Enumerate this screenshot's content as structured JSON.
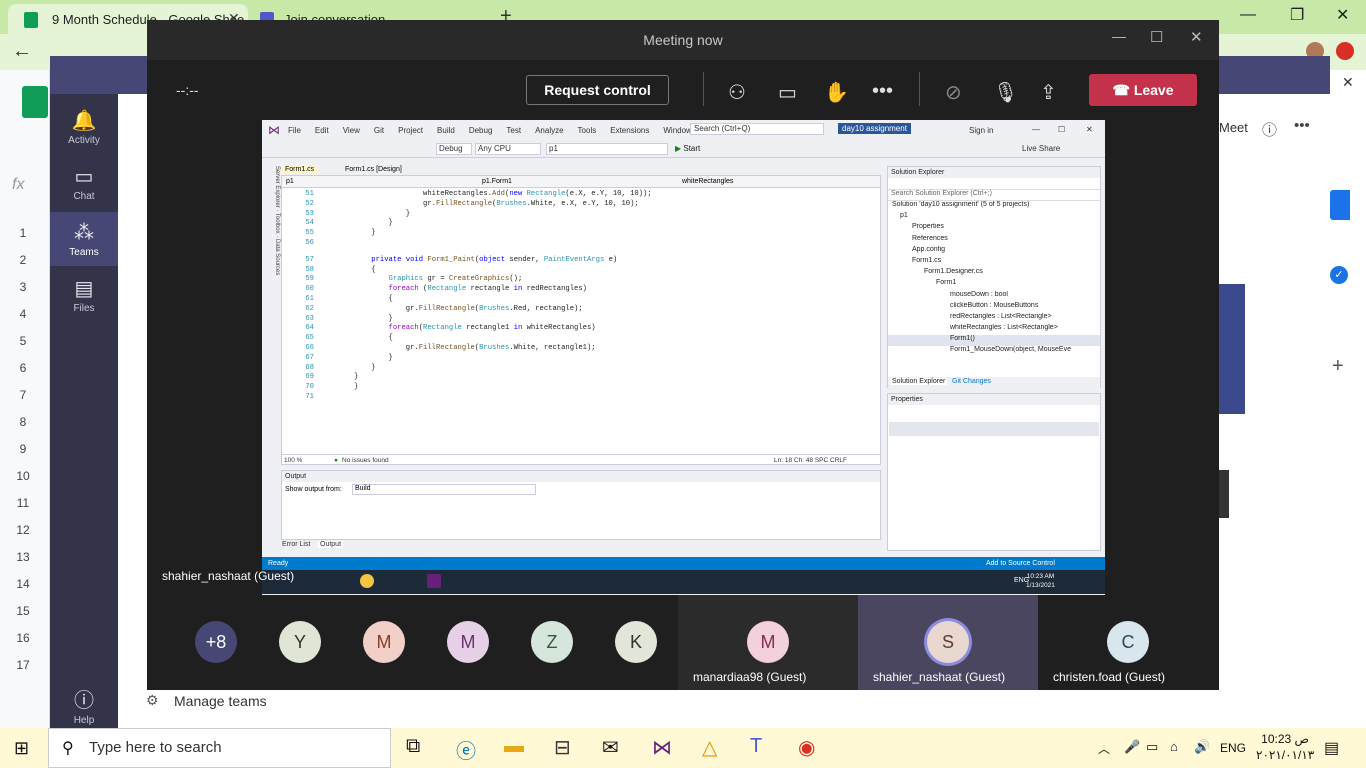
{
  "browser": {
    "tab1": "9 Month Schedule - Google Shee",
    "tab2": "Join conversation"
  },
  "teams": {
    "rail": [
      {
        "label": "Activity"
      },
      {
        "label": "Chat"
      },
      {
        "label": "Teams"
      },
      {
        "label": "Files"
      },
      {
        "label": "Help"
      }
    ],
    "manage": "Manage teams",
    "meet": "Meet"
  },
  "sheet": {
    "rows": [
      "1",
      "2",
      "3",
      "4",
      "5",
      "6",
      "7",
      "8",
      "9",
      "10",
      "11",
      "12",
      "13",
      "14",
      "15",
      "16",
      "17"
    ]
  },
  "meeting": {
    "title": "Meeting now",
    "timer": "--:--",
    "request_control": "Request control",
    "leave": "Leave",
    "presenter": "shahier_nashaat (Guest)"
  },
  "vs": {
    "menus": [
      "File",
      "Edit",
      "View",
      "Git",
      "Project",
      "Build",
      "Debug",
      "Test",
      "Analyze",
      "Tools",
      "Extensions",
      "Window",
      "Help"
    ],
    "search": "Search (Ctrl+Q)",
    "solution": "day10 assignment",
    "signin": "Sign in",
    "liveshare": "Live Share",
    "config": "Debug",
    "cpu": "Any CPU",
    "project": "p1",
    "start": "Start",
    "tab1": "Form1.cs",
    "tab2": "Form1.cs [Design]",
    "nav1": "p1",
    "nav2": "p1.Form1",
    "nav3": "whiteRectangles",
    "zoom": "100 %",
    "issues": "No issues found",
    "pos": "Ln: 18   Ch: 48   SPC   CRLF",
    "output_title": "Output",
    "output_from": "Show output from:",
    "output_sel": "Build",
    "errorlist": "Error List",
    "outputtab": "Output",
    "status": "Ready",
    "source_ctrl": "Add to Source Control",
    "sol_title": "Solution Explorer",
    "sol_search": "Search Solution Explorer (Ctrl+;)",
    "sol_items": [
      "Solution 'day10 assignment' (5 of 5 projects)",
      "p1",
      "Properties",
      "References",
      "App.config",
      "Form1.cs",
      "Form1.Designer.cs",
      "Form1",
      "mouseDown : bool",
      "clickeButton : MouseButtons",
      "redRectangles : List<Rectangle>",
      "whiteRectangles : List<Rectangle>",
      "Form1()",
      "Form1_MouseDown(object, MouseEve"
    ],
    "sol_tab1": "Solution Explorer",
    "sol_tab2": "Git Changes",
    "prop_title": "Properties",
    "inner_clock1": "10:23 AM",
    "inner_clock2": "1/13/2021",
    "inner_lang": "ENG"
  },
  "code": [
    {
      "n": "51",
      "t": "                whiteRectangles.Add(new Rectangle(e.X, e.Y, 10, 10));"
    },
    {
      "n": "52",
      "t": "                gr.FillRectangle(Brushes.White, e.X, e.Y, 10, 10);"
    },
    {
      "n": "53",
      "t": "            }"
    },
    {
      "n": "54",
      "t": "        }"
    },
    {
      "n": "55",
      "t": "    }"
    },
    {
      "n": "56",
      "t": ""
    },
    {
      "n": "57",
      "t": "    private void Form1_Paint(object sender, PaintEventArgs e)"
    },
    {
      "n": "58",
      "t": "    {"
    },
    {
      "n": "59",
      "t": "        Graphics gr = CreateGraphics();"
    },
    {
      "n": "60",
      "t": "        foreach (Rectangle rectangle in redRectangles)"
    },
    {
      "n": "61",
      "t": "        {"
    },
    {
      "n": "62",
      "t": "            gr.FillRectangle(Brushes.Red, rectangle);"
    },
    {
      "n": "63",
      "t": "        }"
    },
    {
      "n": "64",
      "t": "        foreach(Rectangle rectangle1 in whiteRectangles)"
    },
    {
      "n": "65",
      "t": "        {"
    },
    {
      "n": "66",
      "t": "            gr.FillRectangle(Brushes.White, rectangle1);"
    },
    {
      "n": "67",
      "t": "        }"
    },
    {
      "n": "68",
      "t": "    }"
    },
    {
      "n": "69",
      "t": "}"
    },
    {
      "n": "70",
      "t": "}"
    },
    {
      "n": "71",
      "t": ""
    }
  ],
  "participants": [
    {
      "initial": "+8",
      "color": "#464775",
      "fg": "#ffffff"
    },
    {
      "initial": "Y",
      "color": "#e0e6d6",
      "fg": "#333333"
    },
    {
      "initial": "M",
      "color": "#f2d0c8",
      "fg": "#8a3b2c"
    },
    {
      "initial": "M",
      "color": "#e6d0e8",
      "fg": "#6b3270"
    },
    {
      "initial": "Z",
      "color": "#d6e6dc",
      "fg": "#2f5a3c"
    },
    {
      "initial": "K",
      "color": "#e2e6d8",
      "fg": "#333333"
    }
  ],
  "tiles": [
    {
      "initial": "M",
      "name": "manardiaa98 (Guest)",
      "color": "#f2d0dc",
      "fg": "#8a2c4c"
    },
    {
      "initial": "S",
      "name": "shahier_nashaat (Guest)",
      "color": "#e8d8d0",
      "fg": "#5a3c2c"
    },
    {
      "initial": "C",
      "name": "christen.foad (Guest)",
      "color": "#d8e6ee",
      "fg": "#2c4a5a"
    }
  ],
  "taskbar": {
    "search": "Type here to search",
    "time": "10:23 ص",
    "date": "٢٠٢١/٠١/١٣",
    "lang": "ENG"
  }
}
